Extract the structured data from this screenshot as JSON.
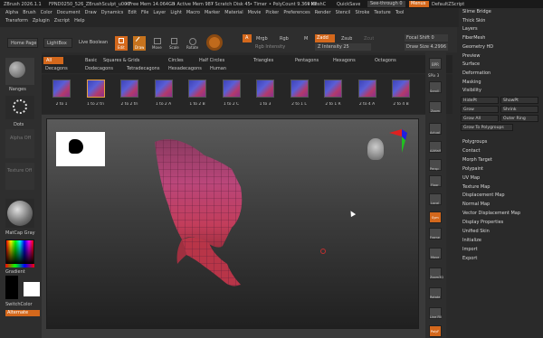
{
  "topbar": {
    "app_title": "ZBrush 2026.1.1",
    "doc_title": "FPND0250_526_ZBrushSculpt_u006",
    "free_mem": "• Free Mem 14.064GB",
    "active_mem": "• Active Mem 987",
    "scratch_disk": "• Scratch Disk 45",
    "timer": "• Timer",
    "polycount": "• PolyCount 9.369 KP",
    "meshcount": "• MeshC",
    "quicksave": "QuickSave",
    "see_through": "See-through 0",
    "menus": "Menus",
    "default_zscript": "DefaultZScript"
  },
  "menubar": [
    "Alpha",
    "Brush",
    "Color",
    "Document",
    "Draw",
    "Dynamics",
    "Edit",
    "File",
    "Layer",
    "Light",
    "Macro",
    "Marker",
    "Material",
    "Movie",
    "Picker",
    "Preferences",
    "Render",
    "Stencil",
    "Stroke",
    "Texture",
    "Tool"
  ],
  "menubar2": [
    "Transform",
    "Zplugin",
    "Zscript",
    "Help"
  ],
  "toolbar": {
    "home_page": "Home Page",
    "lightbox": "LightBox",
    "live_boolean": "Live Boolean",
    "edit": "Edit",
    "draw": "Draw",
    "move": "Move",
    "scale": "Scale",
    "rotate": "Rotate",
    "a_label": "A",
    "mrgb": "Mrgb",
    "rgb": "Rgb",
    "m": "M",
    "zadd": "Zadd",
    "zsub": "Zsub",
    "zcut": "Zcut",
    "rgb_intensity": "Rgb Intensity",
    "z_intensity": "Z Intensity 25",
    "focal_shift": "Focal Shift 0",
    "draw_size": "Draw Size 4.2996"
  },
  "lightbox_tabs": {
    "row1": [
      "All",
      "Basic",
      "Squares & Grids",
      "Circles",
      "Half Circles",
      "Triangles",
      "Pentagons",
      "Hexagons",
      "Octagons"
    ],
    "row2": [
      "Decagons",
      "Dodecagons",
      "Tetradecagons",
      "Hexadecagons",
      "Human"
    ]
  },
  "thumbnails": [
    "2 to 1",
    "1 to 2 tri",
    "2 to 2 tri",
    "1 to 2 A",
    "1 to 2 B",
    "1 to 2 C",
    "1 to 3",
    "2 to 1 L",
    "2 to 1 R",
    "2 to 4 A",
    "2 to 4 B",
    "2 to"
  ],
  "left_panel": {
    "brush_name": "Nanges",
    "stroke_name": "Dots",
    "alpha_label": "Alpha Off",
    "texture_label": "Texture Off",
    "material_label": "MatCap Gray",
    "gradient_label": "Gradient",
    "switch_color": "SwitchColor",
    "alternate": "Alternate"
  },
  "right_menu": {
    "items_top": [
      "Slime Bridge",
      "Thick Skin",
      "Layers",
      "FiberMesh",
      "Geometry HD",
      "Preview",
      "Surface",
      "Deformation",
      "Masking",
      "Visibility"
    ],
    "vis_buttons": [
      [
        "HidePt",
        "ShowPt"
      ],
      [
        "Grow",
        "Shrink"
      ],
      [
        "Grow All",
        "Outer Ring"
      ]
    ],
    "grow_polygroups": "Grow To Polygroups",
    "items_bottom": [
      "Polygroups",
      "Contact",
      "Morph Target",
      "Polypaint",
      "UV Map",
      "Texture Map",
      "Displacement Map",
      "Normal Map",
      "Vector Displacement Map",
      "Display Properties",
      "Unified Skin",
      "Initialize",
      "Import",
      "Export"
    ]
  },
  "right_shelf": {
    "bpr": "BPR",
    "spix": "SPix 3",
    "scroll": "Scroll",
    "zoom": "Zoom",
    "actual": "Actual",
    "aahalf": "AAHalf",
    "persp": "Persp",
    "floor": "Floor",
    "local": "Local",
    "sym": "Sym",
    "frame": "Frame",
    "move": "Move",
    "zoom3d": "Zoom3D",
    "rotate": "Rotate",
    "linefill": "Line Fill",
    "polyf": "PolyF"
  },
  "colors": {
    "accent": "#e8a040",
    "orange_button": "#d4681c",
    "mesh": "#b0406c"
  }
}
